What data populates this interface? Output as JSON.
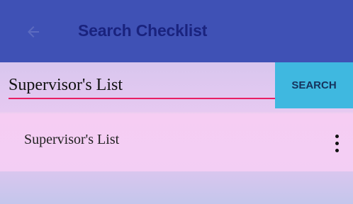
{
  "app_bar": {
    "title": "Search Checklist",
    "back_icon": "arrow-left-icon",
    "background": "#3f51b5"
  },
  "search": {
    "value": "Supervisor's List",
    "button_label": "SEARCH",
    "underline_color": "#e91e63",
    "button_color": "#3fb8e0"
  },
  "results": {
    "items": [
      {
        "label": "Supervisor's List",
        "menu_icon": "more-vert-icon"
      }
    ]
  }
}
